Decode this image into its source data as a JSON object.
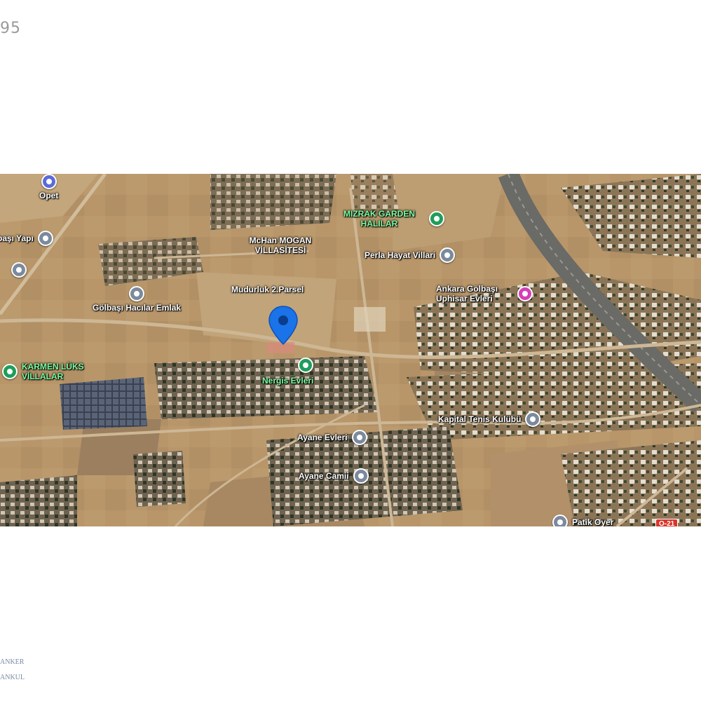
{
  "page": {
    "number_fragment": "95"
  },
  "watermark": {
    "line1": "ANKER",
    "line2": "ANKUL"
  },
  "map": {
    "type": "satellite",
    "center_pin": {
      "color": "#1a73e8"
    },
    "road_shield": "O-21",
    "places": [
      {
        "label": "Opet",
        "icon": "fuel-icon",
        "color": "#5b6bd9"
      },
      {
        "label": "Gölbaşı Yapı",
        "icon": "place-icon",
        "color": "#7b8a9c"
      },
      {
        "label": "",
        "icon": "place-icon",
        "color": "#7b8a9c"
      },
      {
        "label": "Gölbaşı Hacılar Emlak",
        "icon": "place-icon",
        "color": "#7b8a9c"
      },
      {
        "label": "KARMEN LÜKS VİLLALAR",
        "icon": "home-icon",
        "color": "#1e9e5a"
      },
      {
        "label": "MIZRAK GARDEN HALILAR",
        "icon": "park-icon",
        "color": "#1e9e5a"
      },
      {
        "label": "McHan MOGAN VİLLASİTESİ",
        "icon": "place-icon",
        "color": "#7b8a9c"
      },
      {
        "label": "Perla Hayat Villari",
        "icon": "place-icon",
        "color": "#7b8a9c"
      },
      {
        "label": "Ankara Gölbaşı Uphisar Evleri",
        "icon": "hotel-icon",
        "color": "#d63fb5"
      },
      {
        "label": "Mudurluk 2.Parsel",
        "icon": "place-icon",
        "color": "#7b8a9c"
      },
      {
        "label": "Nergis Evleri",
        "icon": "home-icon",
        "color": "#1e9e5a"
      },
      {
        "label": "Kapital Tenis Kulübü",
        "icon": "place-icon",
        "color": "#7b8a9c"
      },
      {
        "label": "Ayane Evleri",
        "icon": "place-icon",
        "color": "#7b8a9c"
      },
      {
        "label": "Ayane Camii",
        "icon": "mosque-icon",
        "color": "#7b8a9c"
      },
      {
        "label": "Patik Oyer",
        "icon": "place-icon",
        "color": "#7b8a9c"
      }
    ]
  }
}
